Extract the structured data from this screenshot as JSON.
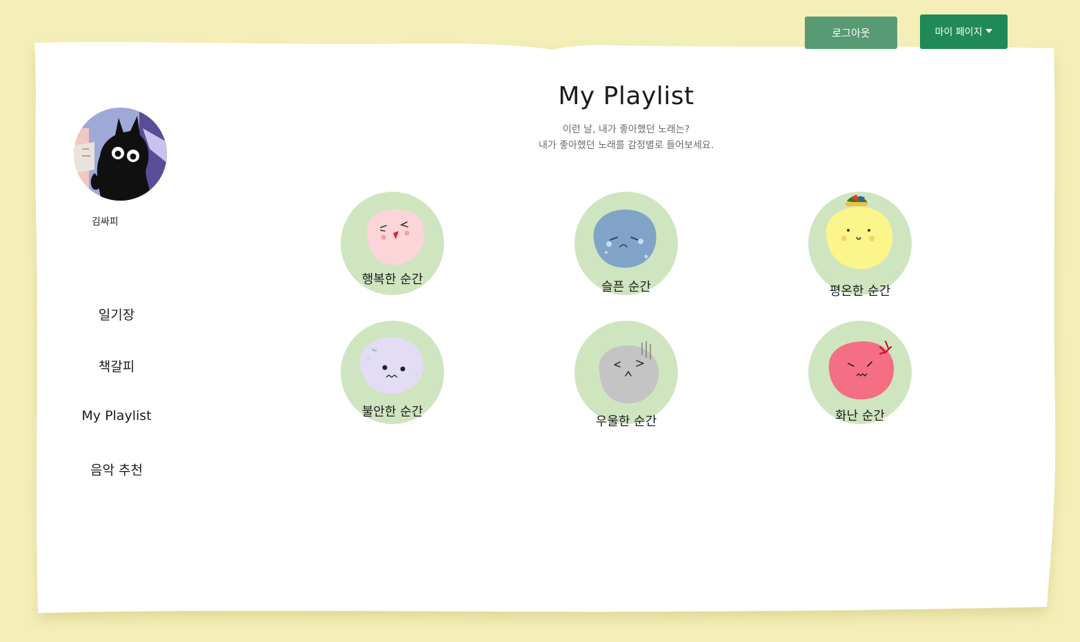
{
  "header": {
    "logout_label": "로그아웃",
    "mypage_label": "마이 페이지"
  },
  "profile": {
    "username": "김싸피"
  },
  "sidebar": {
    "items": [
      {
        "label": "일기장"
      },
      {
        "label": "책갈피"
      },
      {
        "label": "My Playlist"
      },
      {
        "label": "음악 추천"
      }
    ]
  },
  "main": {
    "title": "My Playlist",
    "subtitle_line1": "이런 날, 내가 좋아했던 노래는?",
    "subtitle_line2": "내가 좋아했던 노래를 감정별로 들어보세요."
  },
  "moods": [
    {
      "label": "행복한 순간",
      "icon": "happy-face-icon",
      "color": "#fbd5d8"
    },
    {
      "label": "슬픈 순간",
      "icon": "sad-face-icon",
      "color": "#82a3c8"
    },
    {
      "label": "평온한 순간",
      "icon": "calm-face-icon",
      "color": "#fbf58a"
    },
    {
      "label": "불안한 순간",
      "icon": "anxious-face-icon",
      "color": "#e2dcf5"
    },
    {
      "label": "우울한 순간",
      "icon": "gloomy-face-icon",
      "color": "#c4c4c4"
    },
    {
      "label": "화난 순간",
      "icon": "angry-face-icon",
      "color": "#f46f83"
    }
  ],
  "colors": {
    "background": "#f4efb8",
    "paper": "#ffffff",
    "logout_button": "#589a73",
    "mypage_button": "#1f8a55",
    "mood_disc": "#cfe5c0"
  }
}
